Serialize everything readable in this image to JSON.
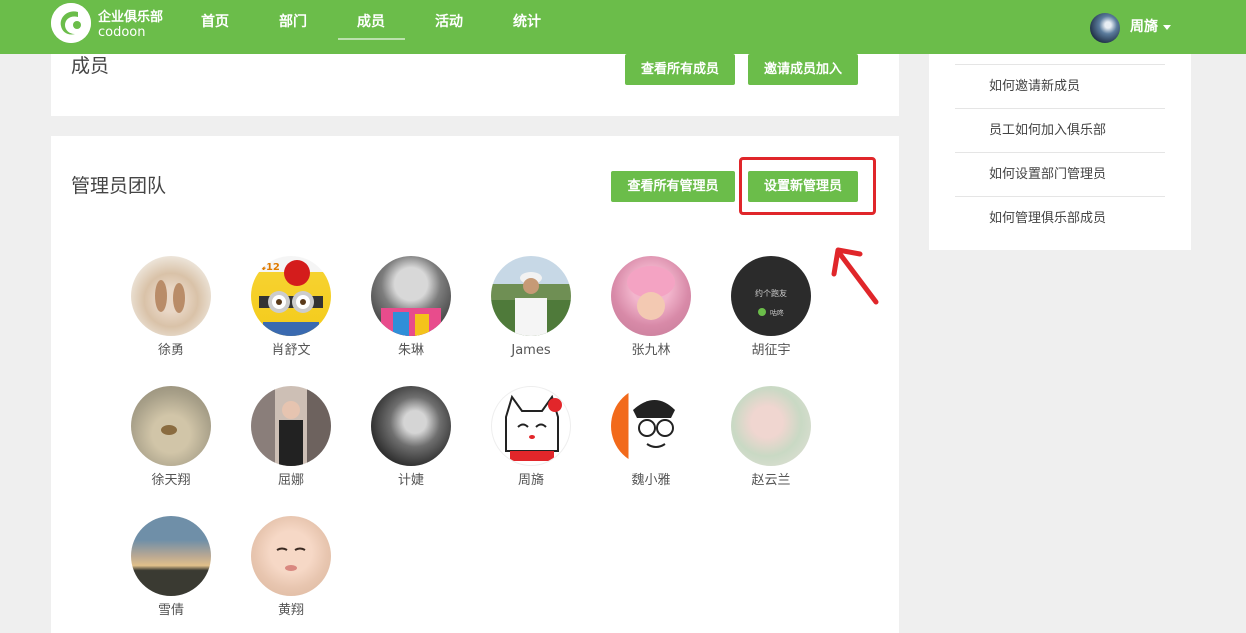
{
  "header": {
    "brand_name": "企业俱乐部",
    "brand_sub": "codoon",
    "nav": [
      "首页",
      "部门",
      "成员",
      "活动",
      "统计"
    ],
    "active_nav": "成员",
    "user_name": "周旖",
    "accent_color": "#6bbd4a"
  },
  "members_panel": {
    "title": "成员",
    "view_all_button": "查看所有成员",
    "invite_button": "邀请成员加入"
  },
  "admin_panel": {
    "title": "管理员团队",
    "view_all_button": "查看所有管理员",
    "set_admin_button": "设置新管理员",
    "members": [
      {
        "name": "徐勇"
      },
      {
        "name": "肖舒文"
      },
      {
        "name": "朱琳"
      },
      {
        "name": "James"
      },
      {
        "name": "张九林"
      },
      {
        "name": "胡征宇"
      },
      {
        "name": "徐天翔"
      },
      {
        "name": "屈娜"
      },
      {
        "name": "计婕"
      },
      {
        "name": "周旖"
      },
      {
        "name": "魏小雅"
      },
      {
        "name": "赵云兰"
      },
      {
        "name": "雪倩"
      },
      {
        "name": "黄翔"
      }
    ],
    "avatar_texts": {
      "run_friend": "约个跑友",
      "codoon_badge": "咕咚",
      "minion_badge": "412"
    }
  },
  "help_panel": {
    "links": [
      "如何邀请新成员",
      "员工如何加入俱乐部",
      "如何设置部门管理员",
      "如何管理俱乐部成员"
    ]
  }
}
